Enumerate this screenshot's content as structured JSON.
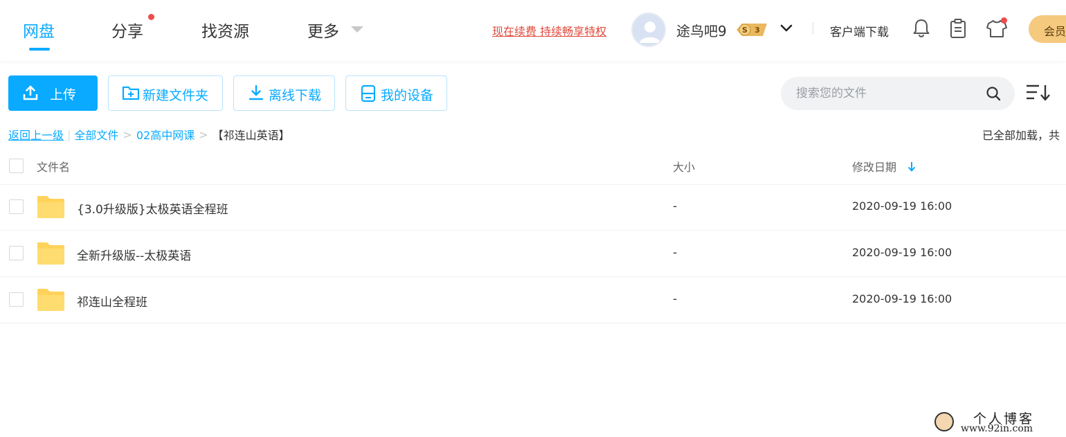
{
  "nav": {
    "items": [
      {
        "label": "网盘"
      },
      {
        "label": "分享"
      },
      {
        "label": "找资源"
      },
      {
        "label": "更多"
      }
    ],
    "promo": "现在续费 持续畅享特权",
    "username": "途鸟吧9",
    "vip_level": "3",
    "vip_prefix": "S",
    "client_download": "客户端下载",
    "member_button": "会员",
    "accent": "#09aaff"
  },
  "toolbar": {
    "upload": "上传",
    "new_folder": "新建文件夹",
    "offline_download": "离线下载",
    "my_devices": "我的设备",
    "search_placeholder": "搜索您的文件"
  },
  "breadcrumb": {
    "back": "返回上一级",
    "all_files": "全部文件",
    "level1": "02高中网课",
    "current": "【祁连山英语】",
    "status": "已全部加载，共"
  },
  "table": {
    "columns": {
      "name": "文件名",
      "size": "大小",
      "date": "修改日期"
    },
    "rows": [
      {
        "name": "{3.0升级版}太极英语全程班",
        "size": "-",
        "date": "2020-09-19 16:00"
      },
      {
        "name": "全新升级版--太极英语",
        "size": "-",
        "date": "2020-09-19 16:00"
      },
      {
        "name": "祁连山全程班",
        "size": "-",
        "date": "2020-09-19 16:00"
      }
    ]
  },
  "watermark": {
    "title": "个人博客",
    "url": "www.92in.com"
  }
}
